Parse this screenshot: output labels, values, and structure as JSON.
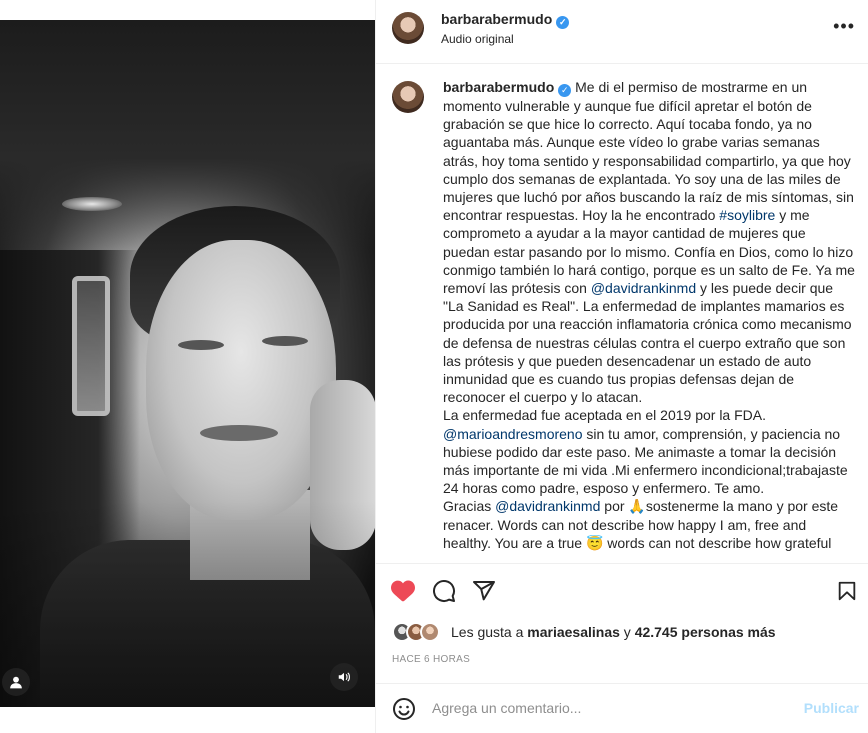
{
  "post": {
    "username": "barbarabermudo",
    "subtitle": "Audio original"
  },
  "caption": {
    "username": "barbarabermudo",
    "segments": [
      {
        "type": "text",
        "text": "Me di el permiso de mostrarme en un momento vulnerable y aunque fue difícil apretar el botón de grabación se que hice lo correcto. Aquí tocaba fondo, ya no aguantaba más. Aunque este vídeo lo grabe varias semanas atrás, hoy toma sentido y responsabilidad compartirlo, ya que hoy cumplo dos semanas de explantada. Yo soy una de las miles de mujeres que luchó por años buscando la raíz de mis síntomas, sin encontrar respuestas. Hoy la he encontrado "
      },
      {
        "type": "mention",
        "text": "#soylibre"
      },
      {
        "type": "text",
        "text": " y me comprometo a ayudar a la mayor cantidad de mujeres que puedan estar pasando por lo mismo. Confía en Dios, como lo hizo conmigo también lo hará contigo, porque es un salto de Fe. Ya me removí las prótesis con "
      },
      {
        "type": "mention",
        "text": "@davidrankinmd"
      },
      {
        "type": "text",
        "text": " y les puede decir que \"La Sanidad es Real\". La enfermedad de implantes mamarios es producida por una reacción inflamatoria crónica como mecanismo de defensa de nuestras células contra el cuerpo extraño que son las prótesis y que pueden desencadenar un estado de auto inmunidad que es cuando tus propias defensas dejan de reconocer el cuerpo y lo atacan."
      },
      {
        "type": "break"
      },
      {
        "type": "text",
        "text": "La enfermedad fue aceptada en el 2019 por la FDA."
      },
      {
        "type": "break"
      },
      {
        "type": "mention",
        "text": "@marioandresmoreno"
      },
      {
        "type": "text",
        "text": " sin tu amor, comprensión, y paciencia no hubiese podido dar este paso. Me animaste a tomar la decisión más importante de mi vida .Mi enfermero incondicional;trabajaste 24 horas como padre, esposo y enfermero. Te amo."
      },
      {
        "type": "break"
      },
      {
        "type": "text",
        "text": "Gracias "
      },
      {
        "type": "mention",
        "text": "@davidrankinmd"
      },
      {
        "type": "text",
        "text": " por 🙏sostenerme la mano y por este renacer. Words can not describe how happy I am, free and healthy. You are a true 😇 words can not describe how grateful"
      }
    ]
  },
  "engagement": {
    "likes_prefix": "Les gusta a ",
    "liker_name": "mariaesalinas",
    "likes_middle": " y ",
    "likes_count": "42.745 personas más",
    "time_ago": "HACE 6 HORAS"
  },
  "comment_box": {
    "placeholder": "Agrega un comentario...",
    "publish_label": "Publicar"
  },
  "icons": {
    "like": "heart-filled-icon",
    "comment": "comment-icon",
    "share": "share-icon",
    "save": "bookmark-icon",
    "more": "more-options-icon",
    "emoji": "emoji-icon",
    "audio": "volume-icon",
    "user_tags": "user-icon"
  },
  "colors": {
    "like": "#ed4956",
    "link": "#00376b",
    "verified": "#3897f0",
    "publish_disabled": "#b2dffc",
    "muted_text": "#8e8e8e"
  }
}
